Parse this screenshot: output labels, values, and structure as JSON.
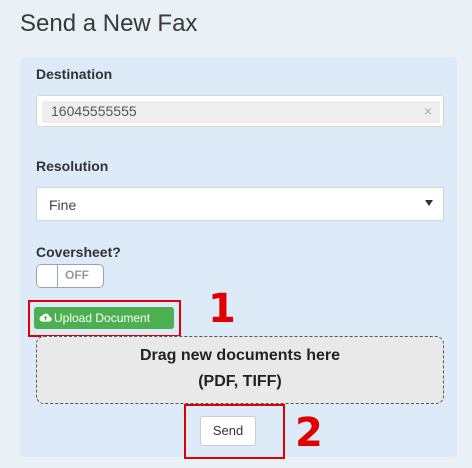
{
  "header": {
    "title": "Send a New Fax"
  },
  "form": {
    "destination": {
      "label": "Destination",
      "value": "16045555555",
      "clear_symbol": "×"
    },
    "resolution": {
      "label": "Resolution",
      "selected": "Fine"
    },
    "coversheet": {
      "label": "Coversheet?",
      "toggle_state": "OFF"
    },
    "upload_label": "Upload Document",
    "dropzone": {
      "line1": "Drag new documents here",
      "line2": "(PDF, TIFF)"
    },
    "send_label": "Send"
  },
  "annotations": {
    "one": "1",
    "two": "2"
  },
  "colors": {
    "annotation": "#e00000",
    "upload_button": "#4caf50",
    "panel": "#dcebf7"
  }
}
